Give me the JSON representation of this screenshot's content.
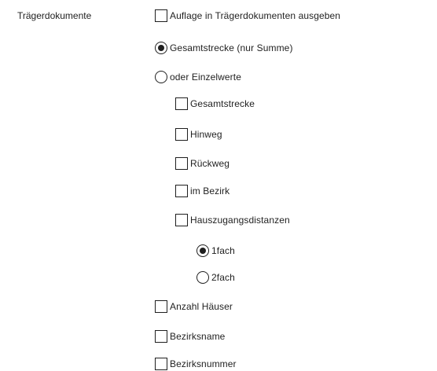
{
  "section": {
    "label": "Trägerdokumente"
  },
  "options": {
    "auflage": {
      "label": "Auflage in Trägerdokumenten ausgeben",
      "checked": false
    },
    "mode": {
      "selected": "gesamtstrecke_summe",
      "gesamtstrecke_summe": {
        "label": "Gesamtstrecke (nur Summe)"
      },
      "einzelwerte": {
        "label": "oder Einzelwerte"
      }
    },
    "einzel": {
      "gesamtstrecke": {
        "label": "Gesamtstrecke",
        "checked": false
      },
      "hinweg": {
        "label": "Hinweg",
        "checked": false
      },
      "rueckweg": {
        "label": "Rückweg",
        "checked": false
      },
      "im_bezirk": {
        "label": "im Bezirk",
        "checked": false
      },
      "hauszugang": {
        "label": "Hauszugangsdistanzen",
        "checked": false
      }
    },
    "faktor": {
      "selected": "1fach",
      "einfach": {
        "label": "1fach"
      },
      "zweifach": {
        "label": "2fach"
      }
    },
    "anzahl_haeuser": {
      "label": "Anzahl Häuser",
      "checked": false
    },
    "bezirksname": {
      "label": "Bezirksname",
      "checked": false
    },
    "bezirksnummer": {
      "label": "Bezirksnummer",
      "checked": false
    }
  }
}
